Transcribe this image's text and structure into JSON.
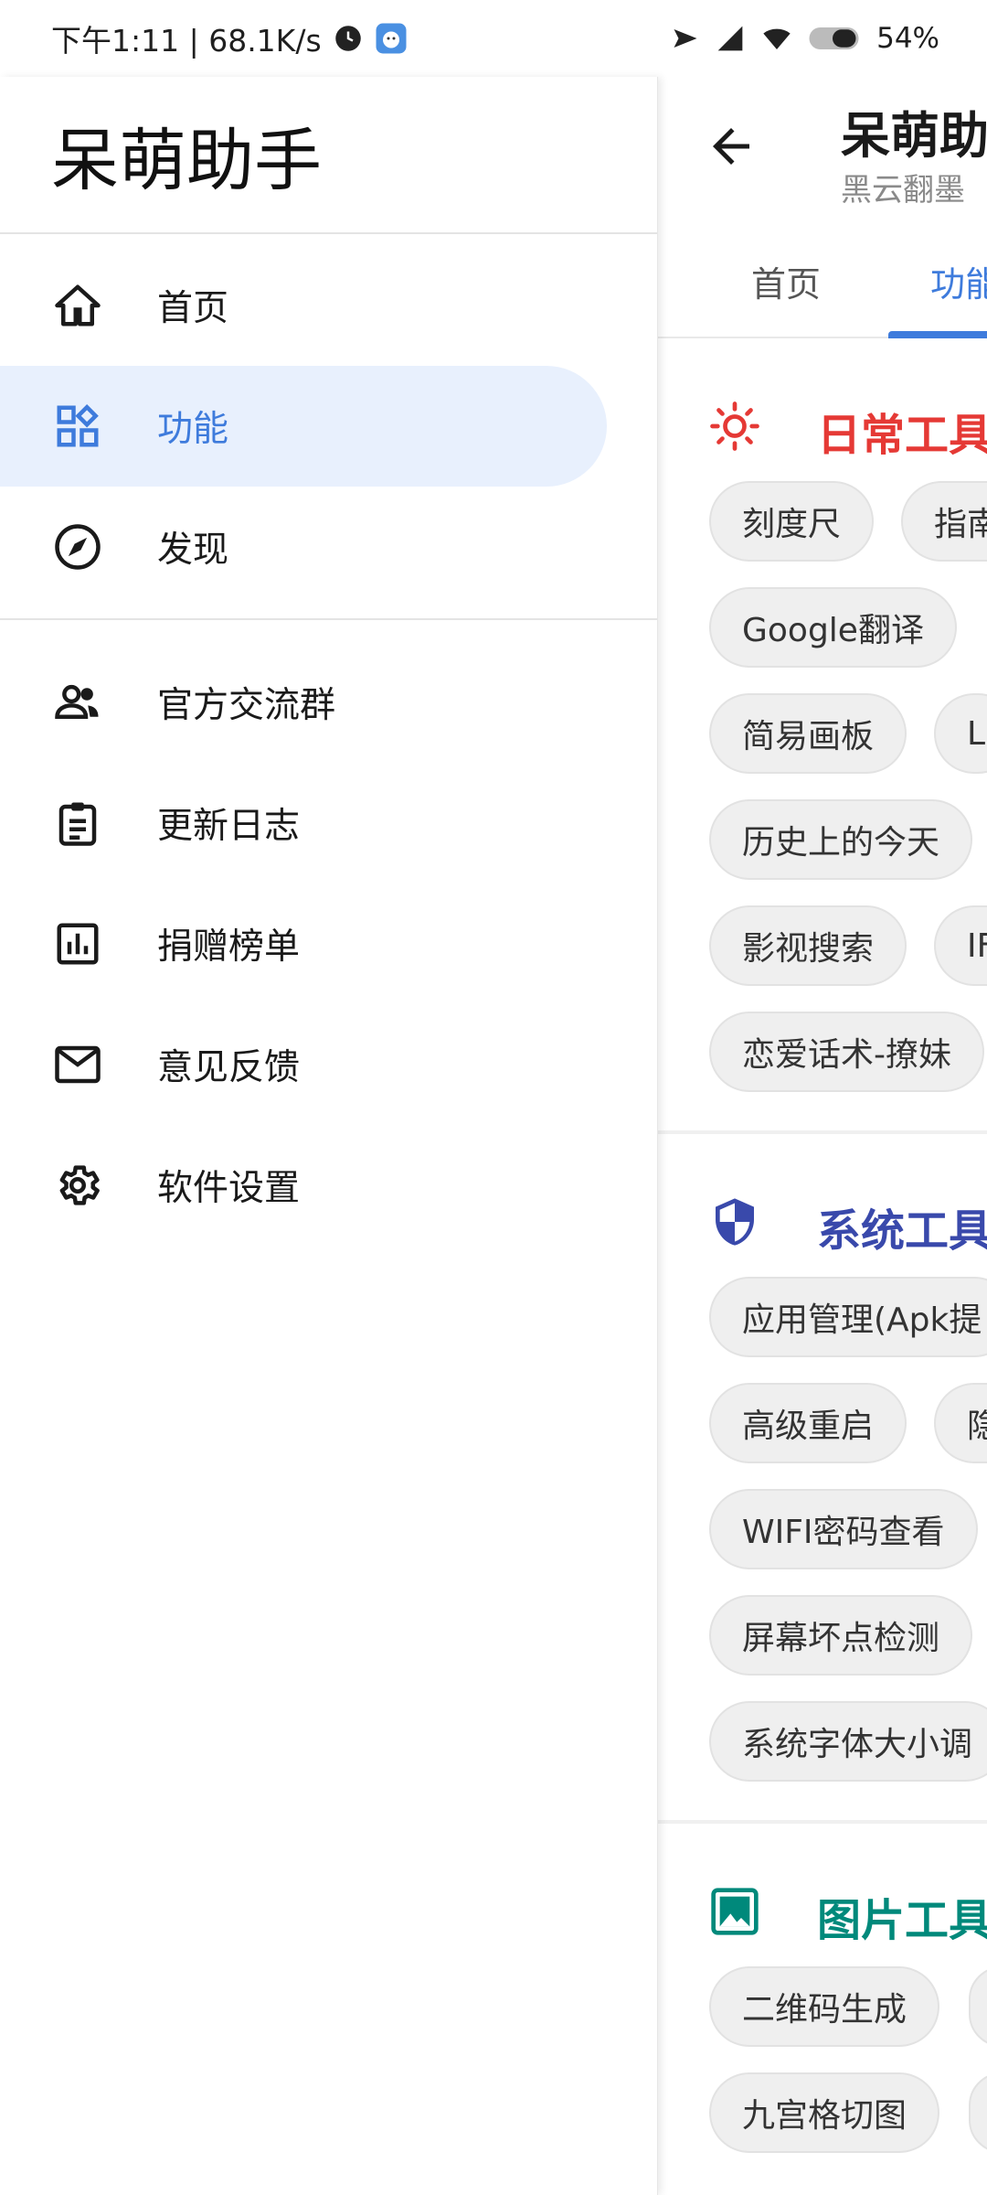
{
  "status_bar": {
    "time_speed": "下午1:11 | 68.1K/s",
    "battery": "54%"
  },
  "drawer": {
    "app_title": "呆萌助手",
    "primary_items": [
      {
        "label": "首页",
        "icon": "home-icon"
      },
      {
        "label": "功能",
        "icon": "apps-grid-icon",
        "active": true
      },
      {
        "label": "发现",
        "icon": "compass-icon"
      }
    ],
    "secondary_items": [
      {
        "label": "官方交流群",
        "icon": "people-icon"
      },
      {
        "label": "更新日志",
        "icon": "clipboard-icon"
      },
      {
        "label": "捐赠榜单",
        "icon": "bar-chart-icon"
      },
      {
        "label": "意见反馈",
        "icon": "mail-icon"
      },
      {
        "label": "软件设置",
        "icon": "gear-icon"
      }
    ]
  },
  "background_screen": {
    "title": "呆萌助",
    "subtitle": "黑云翻墨",
    "tabs": [
      "首页",
      "功能"
    ],
    "sections": [
      {
        "title": "日常工具",
        "color": "#e53935",
        "icon": "sun-icon",
        "chips": [
          "刻度尺",
          "指南",
          "Google翻译",
          "简易画板",
          "L",
          "历史上的今天",
          "影视搜索",
          "IF",
          "恋爱话术-撩妹"
        ]
      },
      {
        "title": "系统工具",
        "color": "#3949ab",
        "icon": "shield-icon",
        "chips": [
          "应用管理(Apk提",
          "高级重启",
          "隐",
          "WIFI密码查看",
          "屏幕坏点检测",
          "系统字体大小调"
        ]
      },
      {
        "title": "图片工具",
        "color": "#00897b",
        "icon": "image-icon",
        "chips": [
          "二维码生成",
          "九宫格切图"
        ]
      }
    ]
  }
}
